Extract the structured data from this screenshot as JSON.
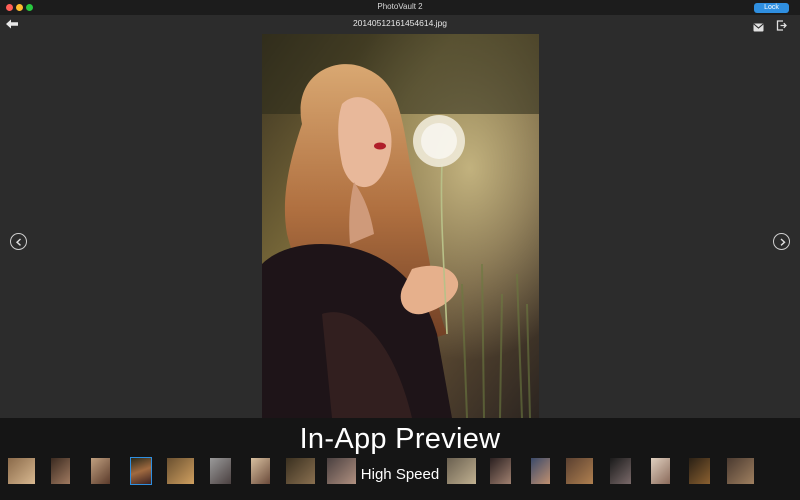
{
  "window": {
    "title": "PhotoVault 2",
    "lock_label": "Lock"
  },
  "toolbar": {
    "filename": "20140512161454614.jpg",
    "back_icon": "back-arrow-icon",
    "mail_icon": "mail-icon",
    "export_icon": "export-icon"
  },
  "viewer": {
    "prev_icon": "chevron-left-icon",
    "next_icon": "chevron-right-icon"
  },
  "promo": {
    "title": "In-App Preview",
    "subtitle": "High Speed"
  },
  "thumbnails": {
    "selected_index": 3
  },
  "colors": {
    "accent": "#2f8fe0",
    "background": "#2c2c2c"
  }
}
